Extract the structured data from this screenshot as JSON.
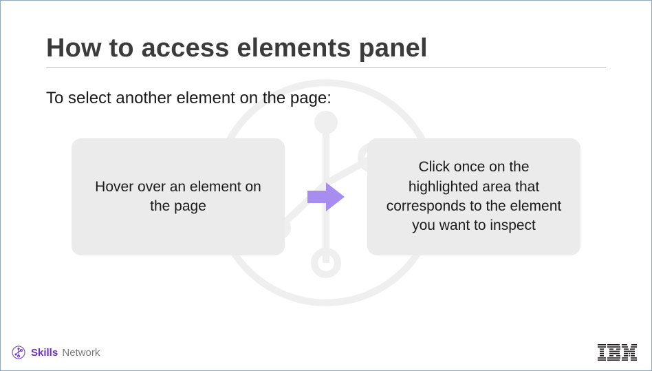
{
  "title": "How to access elements panel",
  "subtitle": "To select another element on the page:",
  "steps": {
    "first": "Hover over an element on the page",
    "second": "Click once on the highlighted area that corresponds to the element you want to inspect"
  },
  "footer": {
    "skills_word": "Skills",
    "network_word": "Network",
    "ibm_label": "IBM"
  },
  "colors": {
    "arrow": "#a88df0",
    "card_bg": "#ebebec",
    "brand_purple": "#6a32c9"
  }
}
